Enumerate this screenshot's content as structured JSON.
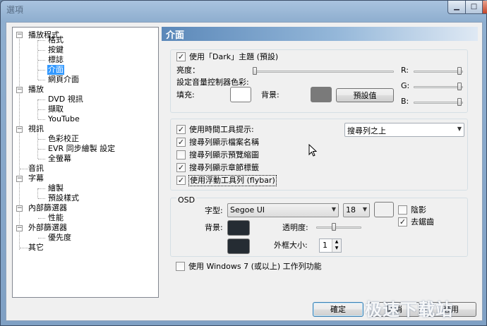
{
  "window": {
    "title": "選項"
  },
  "tree": {
    "items": [
      {
        "label": "播放程式"
      },
      {
        "label": "格式"
      },
      {
        "label": "按鍵"
      },
      {
        "label": "標誌"
      },
      {
        "label": "介面"
      },
      {
        "label": "網頁介面"
      },
      {
        "label": "播放"
      },
      {
        "label": "DVD 視訊"
      },
      {
        "label": "擷取"
      },
      {
        "label": "YouTube"
      },
      {
        "label": "視訊"
      },
      {
        "label": "色彩校正"
      },
      {
        "label": "EVR 同步繪製 設定"
      },
      {
        "label": "全螢幕"
      },
      {
        "label": "音訊"
      },
      {
        "label": "字幕"
      },
      {
        "label": "繪製"
      },
      {
        "label": "預設樣式"
      },
      {
        "label": "內部篩選器"
      },
      {
        "label": "性能"
      },
      {
        "label": "外部篩選器"
      },
      {
        "label": "優先度"
      },
      {
        "label": "其它"
      }
    ],
    "selected": "介面"
  },
  "panel": {
    "title": "介面",
    "theme": {
      "use_dark": {
        "label": "使用「Dark」主題 (預設)",
        "checked": true
      },
      "brightness_label": "亮度：",
      "volume_color_label": "設定音量控制器色彩:",
      "fill_label": "填充:",
      "bg_label": "背景:",
      "default_button": "預設值",
      "r_label": "R:",
      "g_label": "G:",
      "b_label": "B:",
      "fill_color": "#ffffff",
      "bg_color": "#7a7a7a",
      "brightness": 0.0,
      "r": 1.0,
      "g": 1.0,
      "b": 1.0
    },
    "tooltip": {
      "use_time_tooltip": {
        "label": "使用時間工具提示:",
        "checked": true
      },
      "position_select": "搜尋列之上",
      "show_filename": {
        "label": "搜尋列顯示檔案名稱",
        "checked": true
      },
      "show_preview": {
        "label": "搜尋列顯示預覽縮圖",
        "checked": false
      },
      "show_chapters": {
        "label": "搜尋列顯示章節標籤",
        "checked": true
      },
      "use_flybar": {
        "label": "使用浮動工具列 (flybar)",
        "checked": true
      }
    },
    "osd": {
      "title": "OSD",
      "font_label": "字型:",
      "font_value": "Segoe UI",
      "size_value": "18",
      "shadow": {
        "label": "陰影",
        "checked": false
      },
      "antialias": {
        "label": "去鋸齒",
        "checked": true
      },
      "bg_label": "背景:",
      "opacity_label": "透明度:",
      "border_label": "外框大小:",
      "border_value": "1",
      "bg_color": "#252c33",
      "border_color": "#252c33",
      "font_color": "#f0f0f0",
      "opacity": 0.25
    },
    "win7": {
      "label": "使用 Windows 7 (或以上) 工作列功能",
      "checked": false
    }
  },
  "footer": {
    "ok": "確定",
    "cancel": "取消",
    "apply": "套用"
  },
  "watermark": "极速下载站"
}
